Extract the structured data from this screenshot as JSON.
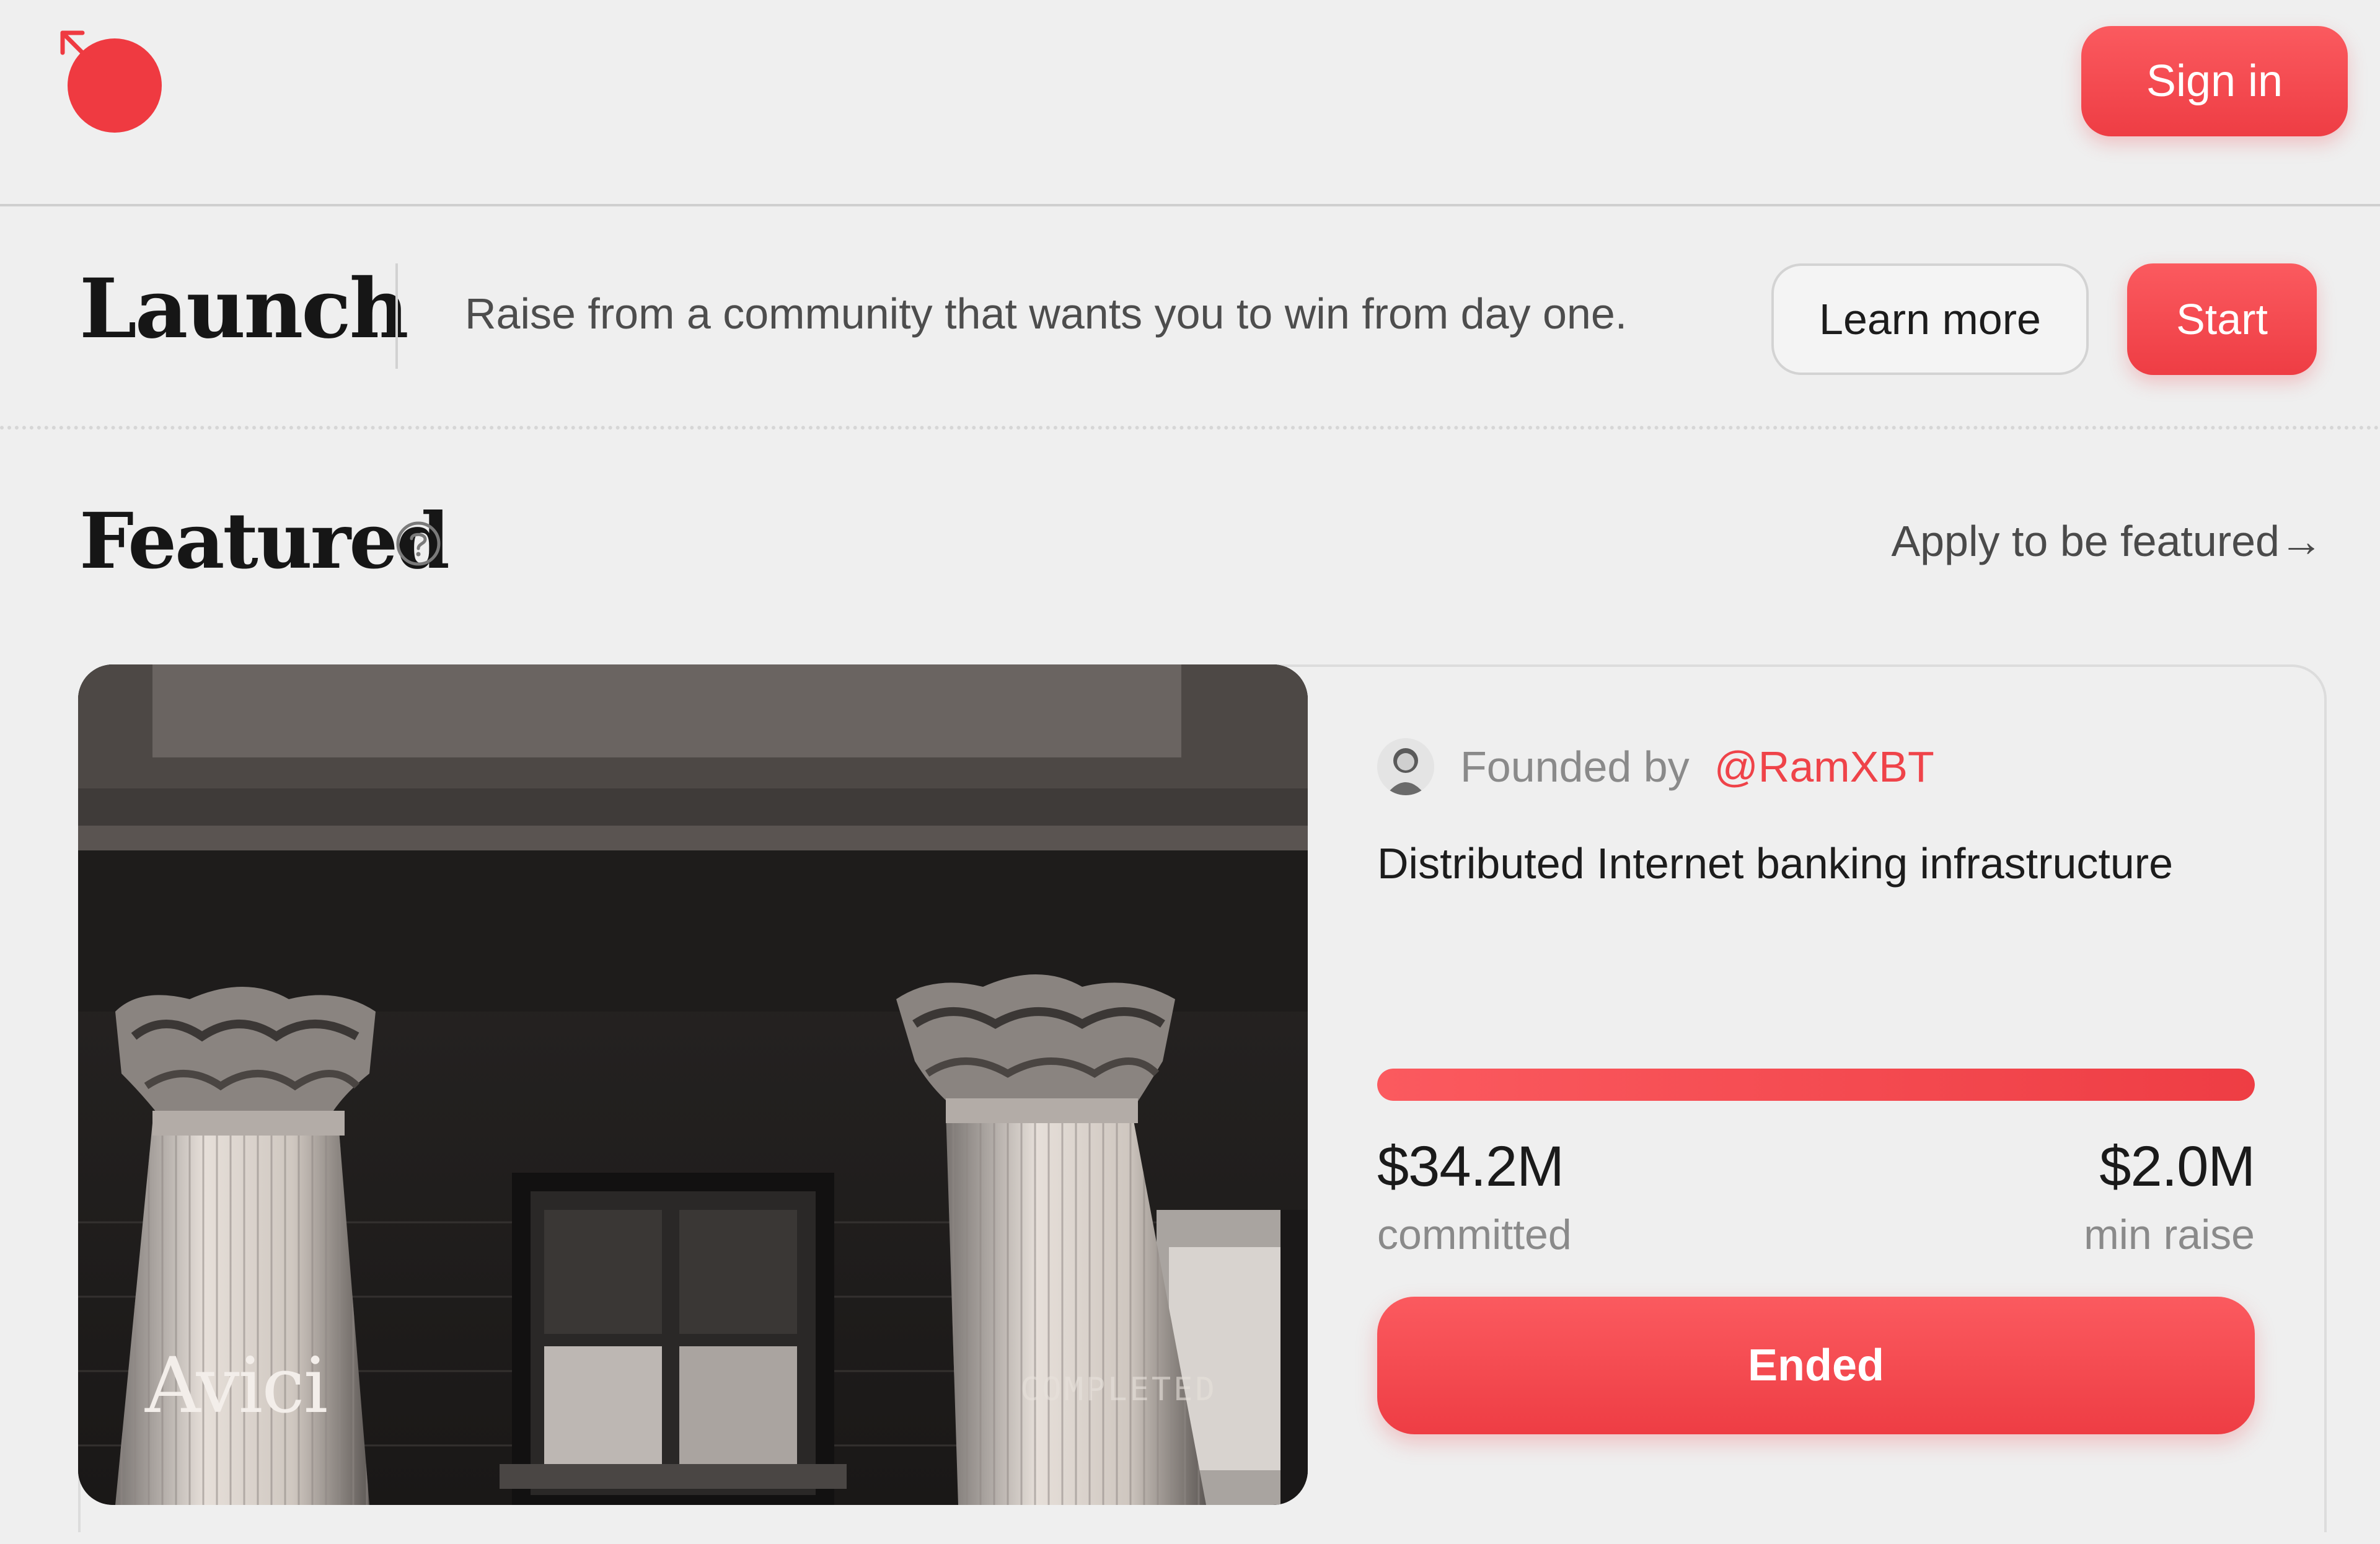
{
  "header": {
    "logo_icon": "red-dot-arrow-logo-icon",
    "signin_label": "Sign in"
  },
  "launch": {
    "title": "Launch",
    "tagline": "Raise from a community that wants you to win from day one.",
    "learn_more_label": "Learn more",
    "start_label": "Start"
  },
  "featured": {
    "title": "Featured",
    "help_icon": "question-circle-icon",
    "apply_link": "Apply to be featured→"
  },
  "card": {
    "image_icon": "classical-columns-building-image",
    "project_name": "Avici",
    "status": "COMPLETED",
    "founded_by_label": "Founded by",
    "founder_handle": "@RamXBT",
    "description": "Distributed Internet banking infrastructure",
    "progress_fraction": 1.0,
    "committed_value": "$34.2M",
    "committed_label": "committed",
    "min_raise_value": "$2.0M",
    "min_raise_label": "min raise",
    "action_label": "Ended"
  },
  "colors": {
    "accent": "#ef4349",
    "background": "#efefef",
    "text": "#1c1c1c",
    "muted": "#8a8a8a"
  }
}
